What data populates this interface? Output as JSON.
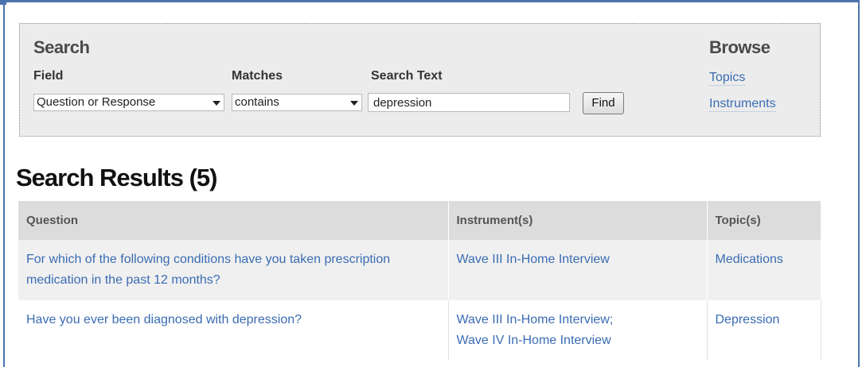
{
  "search": {
    "heading": "Search",
    "field_label": "Field",
    "matches_label": "Matches",
    "text_label": "Search Text",
    "field_value": "Question or Response",
    "matches_value": "contains",
    "text_value": "depression",
    "find_label": "Find"
  },
  "browse": {
    "heading": "Browse",
    "links": [
      "Topics",
      "Instruments"
    ]
  },
  "results": {
    "title": "Search Results (5)",
    "columns": [
      "Question",
      "Instrument(s)",
      "Topic(s)"
    ],
    "rows": [
      {
        "question": "For which of the following conditions have you taken prescription medication in the past 12 months?",
        "instruments": [
          "Wave III In-Home Interview"
        ],
        "topic": "Medications"
      },
      {
        "question": "Have you ever been diagnosed with depression?",
        "instruments": [
          "Wave III In-Home Interview;",
          "Wave IV In-Home Interview"
        ],
        "topic": "Depression"
      }
    ]
  },
  "colors": {
    "link": "#3a6cb3",
    "frame": "#4a74ad",
    "panel": "#ececec",
    "header_row": "#dcdcdc"
  }
}
